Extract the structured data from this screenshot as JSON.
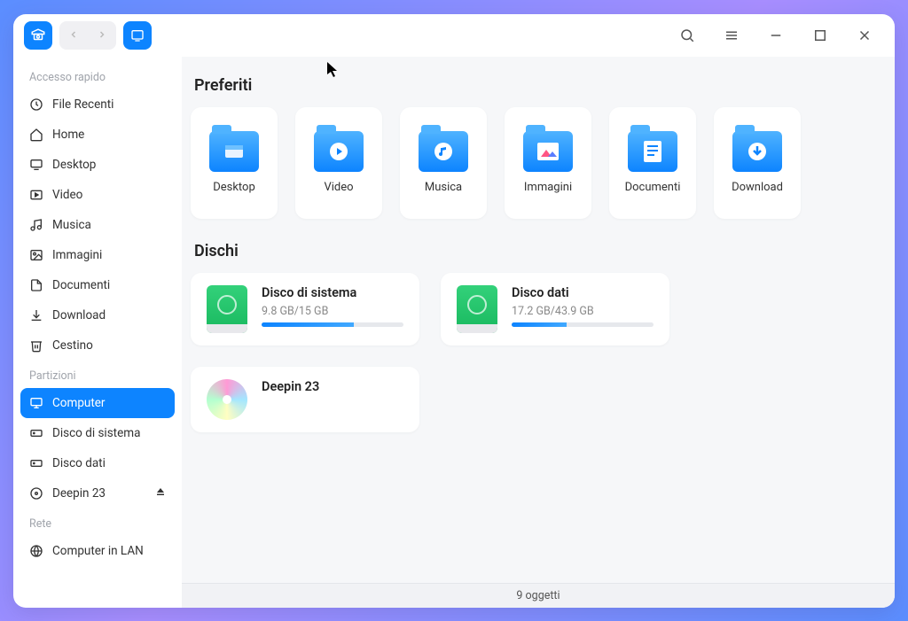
{
  "sidebar": {
    "sections": [
      {
        "header": "Accesso rapido",
        "items": [
          {
            "icon": "clock",
            "label": "File Recenti"
          },
          {
            "icon": "home",
            "label": "Home"
          },
          {
            "icon": "desktop",
            "label": "Desktop"
          },
          {
            "icon": "video",
            "label": "Video"
          },
          {
            "icon": "music",
            "label": "Musica"
          },
          {
            "icon": "image",
            "label": "Immagini"
          },
          {
            "icon": "doc",
            "label": "Documenti"
          },
          {
            "icon": "download",
            "label": "Download"
          },
          {
            "icon": "trash",
            "label": "Cestino"
          }
        ]
      },
      {
        "header": "Partizioni",
        "items": [
          {
            "icon": "monitor",
            "label": "Computer",
            "active": true
          },
          {
            "icon": "hdd",
            "label": "Disco di sistema"
          },
          {
            "icon": "hdd",
            "label": "Disco dati"
          },
          {
            "icon": "cd",
            "label": "Deepin 23",
            "eject": true
          }
        ]
      },
      {
        "header": "Rete",
        "items": [
          {
            "icon": "lan",
            "label": "Computer in LAN"
          }
        ]
      }
    ]
  },
  "main": {
    "favorites_title": "Preferiti",
    "favorites": [
      {
        "label": "Desktop",
        "inner": "desktop"
      },
      {
        "label": "Video",
        "inner": "video"
      },
      {
        "label": "Musica",
        "inner": "music"
      },
      {
        "label": "Immagini",
        "inner": "image"
      },
      {
        "label": "Documenti",
        "inner": "doc"
      },
      {
        "label": "Download",
        "inner": "download"
      }
    ],
    "disks_title": "Dischi",
    "disks": [
      {
        "name": "Disco di sistema",
        "size": "9.8 GB/15 GB",
        "pct": 65,
        "type": "hdd"
      },
      {
        "name": "Disco dati",
        "size": "17.2 GB/43.9 GB",
        "pct": 39,
        "type": "hdd"
      },
      {
        "name": "Deepin 23",
        "size": "",
        "pct": 0,
        "type": "cd"
      }
    ]
  },
  "status": "9 oggetti"
}
